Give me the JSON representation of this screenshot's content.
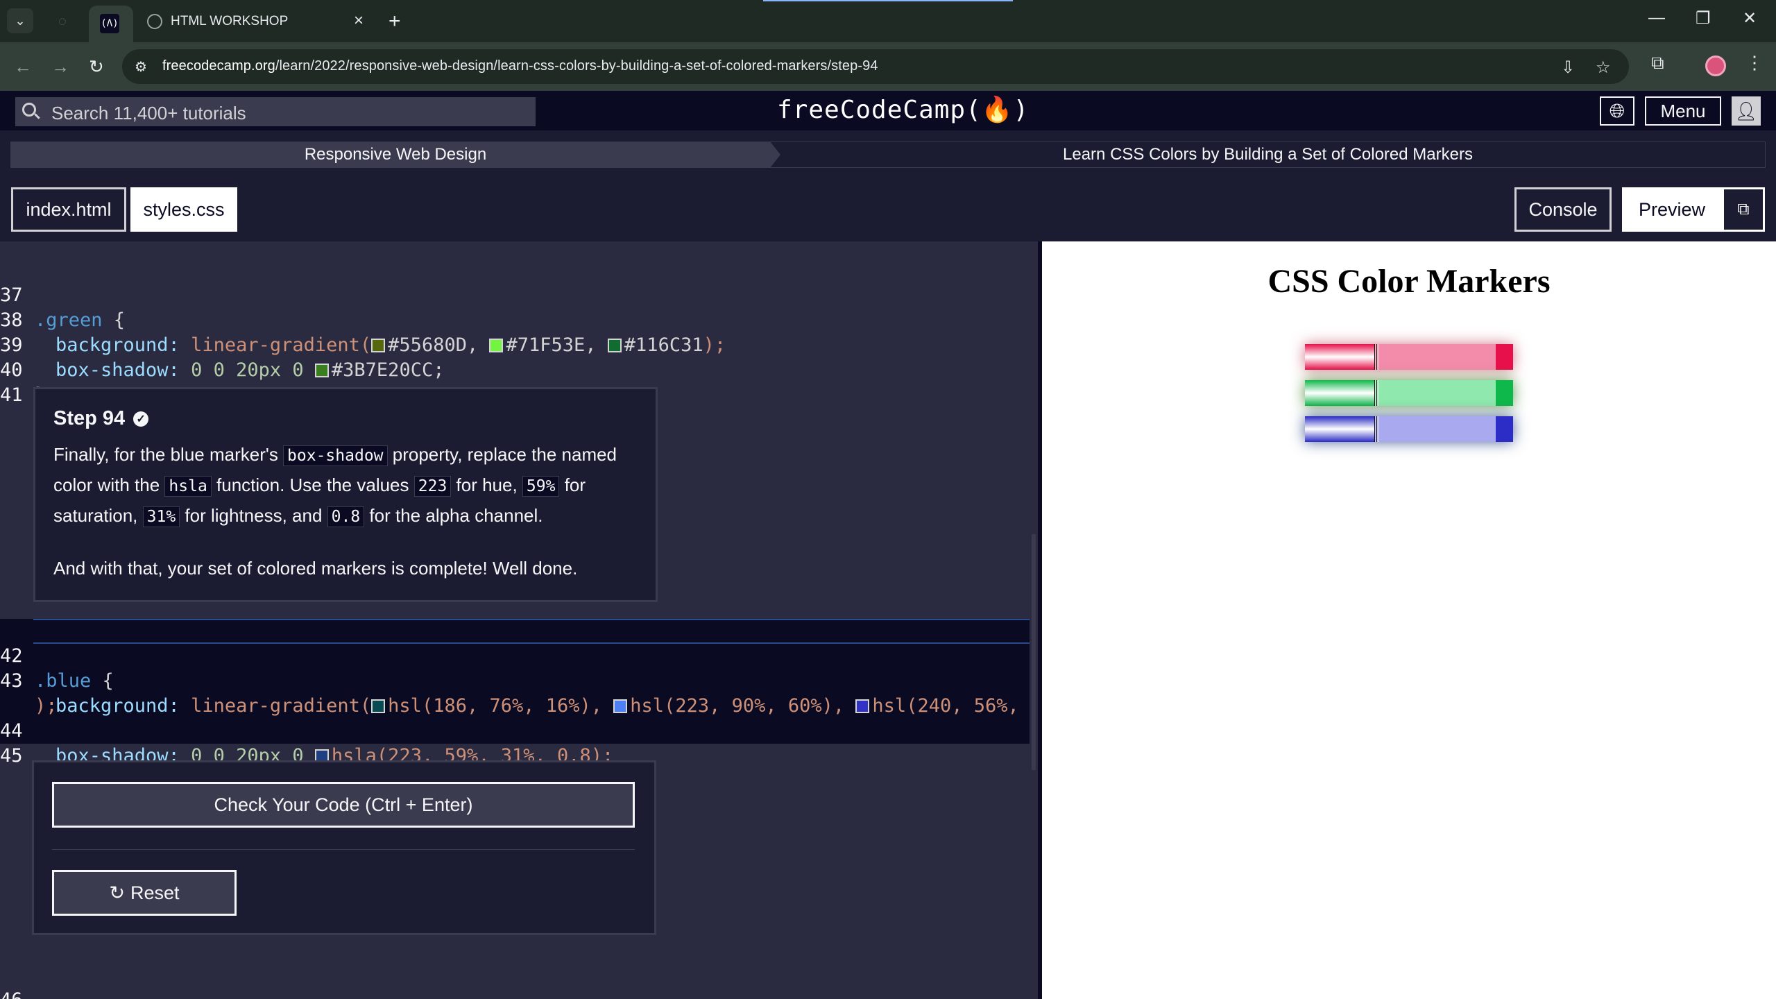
{
  "browser": {
    "active_tab_icon_text": "(Λ)",
    "tab_title": "HTML WORKSHOP",
    "url_host": "freecodecamp.org",
    "url_path": "/learn/2022/responsive-web-design/learn-css-colors-by-building-a-set-of-colored-markers/step-94"
  },
  "header": {
    "search_placeholder": "Search 11,400+ tutorials",
    "brand": "freeCodeCamp(🔥)",
    "menu_label": "Menu"
  },
  "breadcrumb": {
    "section": "Responsive Web Design",
    "course": "Learn CSS Colors by Building a Set of Colored Markers"
  },
  "editor": {
    "tabs": [
      "index.html",
      "styles.css"
    ],
    "console_label": "Console",
    "preview_label": "Preview",
    "lines": {
      "l37": {
        "num": "37",
        "sel": ".green",
        "rest": " {"
      },
      "l38": {
        "num": "38",
        "prop": "background:",
        "fn": "linear-gradient(",
        "c1": "#55680D",
        "c2": "#71F53E",
        "c3": "#116C31",
        "close": ");",
        "sw1": "#55680D",
        "sw2": "#71F53E",
        "sw3": "#116C31"
      },
      "l39": {
        "num": "39",
        "prop": "box-shadow:",
        "vals": "0 0 20px 0",
        "c1": "#3B7E20CC;",
        "sw1": "#3B7E20"
      },
      "l40": {
        "num": "40",
        "text": "}"
      },
      "l41": {
        "num": "41"
      },
      "l42": {
        "num": "42",
        "sel": ".blue",
        "rest": " {"
      },
      "l43": {
        "num": "43",
        "prop": "background:",
        "fn": "linear-gradient(",
        "c1": "hsl(186, 76%, 16%),",
        "c2": "hsl(223, 90%, 60%),",
        "c3": "hsl(240, 56%,",
        "wrap": ");",
        "sw1": "#0a4a52",
        "sw2": "#4d7ff5",
        "sw3": "#3232c5"
      },
      "l44": {
        "num": "44",
        "prop": "box-shadow:",
        "vals": "0 0 20px 0",
        "c1": "hsla(223, 59%, 31%, 0.8);",
        "sw1": "#203f80"
      },
      "l45": {
        "num": "45",
        "text": "}"
      },
      "l46": {
        "num": "46"
      }
    }
  },
  "step": {
    "title": "Step 94",
    "p1_a": "Finally, for the blue marker's ",
    "p1_code1": "box-shadow",
    "p1_b": " property, replace the named color with the ",
    "p1_code2": "hsla",
    "p1_c": " function. Use the values ",
    "p1_code3": "223",
    "p1_d": " for hue, ",
    "p1_code4": "59%",
    "p1_e": " for saturation, ",
    "p1_code5": "31%",
    "p1_f": " for lightness, and ",
    "p1_code6": "0.8",
    "p1_g": " for the alpha channel.",
    "p2": "And with that, your set of colored markers is complete! Well done.",
    "check_label": "Check Your Code (Ctrl + Enter)",
    "reset_label": "Reset"
  },
  "preview": {
    "title": "CSS Color Markers",
    "markers": [
      {
        "name": "red",
        "cap": "#e8104b",
        "sleeve": "#f38bab",
        "shadow": "rgba(180,30,60,0.6)"
      },
      {
        "name": "green",
        "cap": "#0fb84a",
        "sleeve": "#8fe8ad",
        "shadow": "rgba(59,126,32,0.8)"
      },
      {
        "name": "blue",
        "cap": "#2c2cc6",
        "sleeve": "#a9a9f0",
        "shadow": "rgba(32,63,128,0.8)"
      }
    ]
  }
}
